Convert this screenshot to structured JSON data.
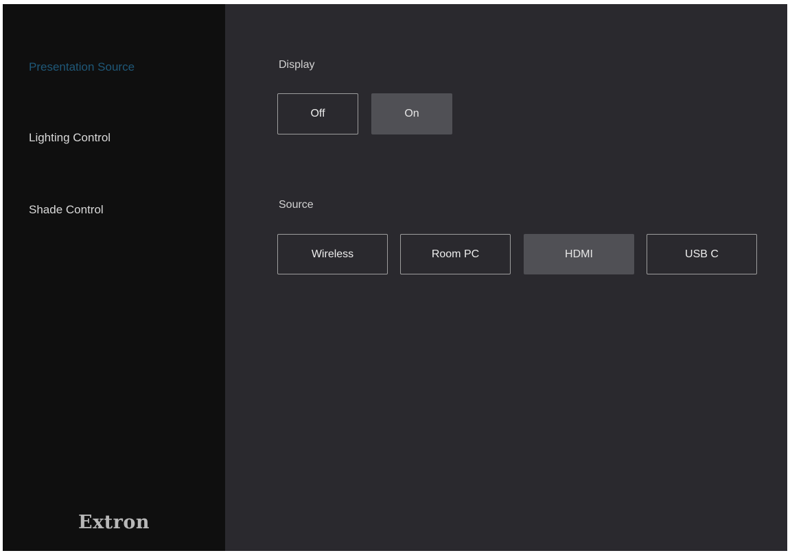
{
  "sidebar": {
    "items": [
      {
        "label": "Presentation Source",
        "active": true
      },
      {
        "label": "Lighting Control",
        "active": false
      },
      {
        "label": "Shade Control",
        "active": false
      }
    ],
    "logo": "Extron"
  },
  "display": {
    "label": "Display",
    "buttons": [
      {
        "label": "Off",
        "selected": false
      },
      {
        "label": "On",
        "selected": true
      }
    ]
  },
  "source": {
    "label": "Source",
    "buttons": [
      {
        "label": "Wireless",
        "selected": false
      },
      {
        "label": "Room PC",
        "selected": false
      },
      {
        "label": "HDMI",
        "selected": true
      },
      {
        "label": "USB C",
        "selected": false
      }
    ]
  },
  "colors": {
    "sidebar_bg": "#0f0f0f",
    "main_bg": "#2a292e",
    "active_nav": "#1f5878",
    "selected_button": "#505055",
    "button_border": "#9e9e9e"
  }
}
